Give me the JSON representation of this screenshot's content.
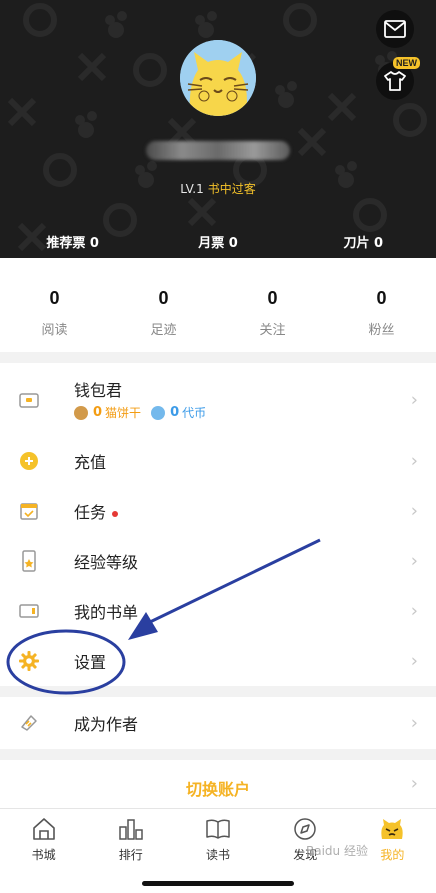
{
  "header": {
    "level_prefix": "LV.1",
    "level_title": "书中过客",
    "new_badge": "NEW",
    "tickets": [
      {
        "label": "推荐票 0"
      },
      {
        "label": "月票 0"
      },
      {
        "label": "刀片 0"
      }
    ]
  },
  "stats": [
    {
      "value": "0",
      "label": "阅读"
    },
    {
      "value": "0",
      "label": "足迹"
    },
    {
      "value": "0",
      "label": "关注"
    },
    {
      "value": "0",
      "label": "粉丝"
    }
  ],
  "menu": {
    "wallet": {
      "label": "钱包君",
      "cat_amount": "0",
      "cat_unit": "猫饼干",
      "book_amount": "0",
      "book_unit": "代币"
    },
    "recharge": "充值",
    "tasks": "任务",
    "exp_level": "经验等级",
    "my_booklist": "我的书单",
    "settings": "设置",
    "become_author": "成为作者",
    "switch_account": "切换账户"
  },
  "tabbar": [
    {
      "label": "书城",
      "icon": "store-icon"
    },
    {
      "label": "排行",
      "icon": "ranking-icon"
    },
    {
      "label": "读书",
      "icon": "book-icon"
    },
    {
      "label": "发现",
      "icon": "compass-icon"
    },
    {
      "label": "我的",
      "icon": "cat-face-icon"
    }
  ],
  "watermark": "Baidu 经验",
  "colors": {
    "accent": "#f5b324",
    "annotation": "#2a3fa0",
    "header_bg": "#1d1d1d"
  }
}
